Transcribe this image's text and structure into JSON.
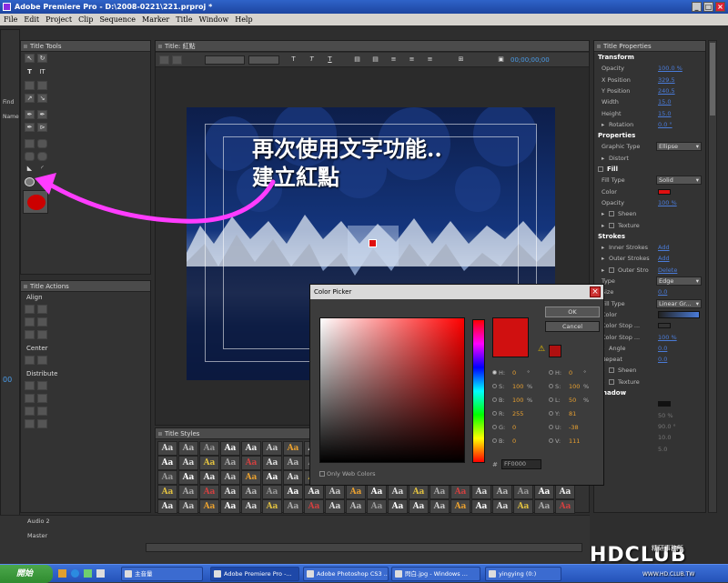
{
  "window": {
    "title": "Adobe Premiere Pro - D:\\2008-0221\\221.prproj *"
  },
  "menu": [
    "File",
    "Edit",
    "Project",
    "Clip",
    "Sequence",
    "Marker",
    "Title",
    "Window",
    "Help"
  ],
  "title_tools": {
    "tab": "Title Tools"
  },
  "title_actions": {
    "tab": "Title Actions",
    "align": "Align",
    "center": "Center",
    "distribute": "Distribute"
  },
  "title_panel": {
    "tab": "Title: 紅點",
    "timecode": "00;00;00;00"
  },
  "annotation": "再次使用文字功能..\n建立紅點",
  "title_styles": {
    "tab": "Title Styles",
    "sample": "Aa"
  },
  "left_side": {
    "find": "Find",
    "name": "Name",
    "timecode": "00"
  },
  "timeline": {
    "audio2": "Audio 2",
    "master": "Master"
  },
  "properties": {
    "tab": "Title Properties",
    "rows": [
      {
        "type": "section",
        "label": "Transform"
      },
      {
        "label": "Opacity",
        "value": "100.0 %"
      },
      {
        "label": "X Position",
        "value": "329.5"
      },
      {
        "label": "Y Position",
        "value": "240.5"
      },
      {
        "label": "Width",
        "value": "15.0"
      },
      {
        "label": "Height",
        "value": "15.0"
      },
      {
        "label": "Rotation",
        "value": "0.0 °",
        "arrow": true
      },
      {
        "type": "section",
        "label": "Properties"
      },
      {
        "label": "Graphic Type",
        "dropdown": "Ellipse"
      },
      {
        "label": "Distort",
        "arrow": true
      },
      {
        "type": "section",
        "label": "Fill",
        "check": true
      },
      {
        "label": "Fill Type",
        "dropdown": "Solid"
      },
      {
        "label": "Color",
        "swatch": "#e01010"
      },
      {
        "label": "Opacity",
        "value": "100 %"
      },
      {
        "label": "Sheen",
        "check": true,
        "arrow": true
      },
      {
        "label": "Texture",
        "check": true,
        "arrow": true
      },
      {
        "type": "section",
        "label": "Strokes"
      },
      {
        "label": "Inner Strokes",
        "value": "Add",
        "arrow": true
      },
      {
        "label": "Outer Strokes",
        "value": "Add",
        "arrow": true
      },
      {
        "label": "Outer Stro",
        "value": "Delete",
        "check": true,
        "arrow": true
      },
      {
        "label": "Type",
        "dropdown": "Edge"
      },
      {
        "label": "Size",
        "value": "0.0"
      },
      {
        "label": "Fill Type",
        "dropdown": "Linear Gr..."
      },
      {
        "label": "Color",
        "gradient": true
      },
      {
        "label": "Color Stop ...",
        "swatch": "#333333"
      },
      {
        "label": "Color Stop ...",
        "value": "100 %"
      },
      {
        "label": "Angle",
        "value": "0.0",
        "arrow": true
      },
      {
        "label": "Repeat",
        "value": "0.0"
      },
      {
        "label": "Sheen",
        "check": true,
        "arrow": true
      },
      {
        "label": "Texture",
        "check": true,
        "arrow": true
      },
      {
        "type": "section",
        "label": "Shadow"
      },
      {
        "label": "",
        "swatch": "#111111"
      },
      {
        "label": "",
        "value": "50 %",
        "dim": true
      },
      {
        "label": "",
        "value": "90.0 °",
        "dim": true
      },
      {
        "label": "",
        "value": "10.0",
        "dim": true
      },
      {
        "label": "",
        "value": "5.0",
        "dim": true
      }
    ]
  },
  "color_picker": {
    "title": "Color Picker",
    "ok": "OK",
    "cancel": "Cancel",
    "only_web": "Only Web Colors",
    "hex": "FF0000",
    "swatch": "#d01010",
    "warn_swatch": "#b01010",
    "left": [
      {
        "k": "H:",
        "v": "0",
        "u": "°",
        "checked": true
      },
      {
        "k": "S:",
        "v": "100",
        "u": "%"
      },
      {
        "k": "B:",
        "v": "100",
        "u": "%"
      },
      {
        "k": "R:",
        "v": "255",
        "u": ""
      },
      {
        "k": "G:",
        "v": "0",
        "u": ""
      },
      {
        "k": "B:",
        "v": "0",
        "u": ""
      }
    ],
    "right": [
      {
        "k": "H:",
        "v": "0",
        "u": "°"
      },
      {
        "k": "S:",
        "v": "100",
        "u": "%"
      },
      {
        "k": "L:",
        "v": "50",
        "u": "%"
      },
      {
        "k": "Y:",
        "v": "81",
        "u": ""
      },
      {
        "k": "U:",
        "v": "-38",
        "u": ""
      },
      {
        "k": "V:",
        "v": "111",
        "u": ""
      }
    ]
  },
  "taskbar": {
    "start": "開始",
    "buttons": [
      "主音量",
      "Adobe Premiere Pro -...",
      "Adobe Photoshop CS3 ...",
      "閃白.jpg - Windows ...",
      "yingying (0:)"
    ]
  },
  "logo": {
    "main": "HDCLUB",
    "sub": "精研事務所",
    "url": "WWW.HD.CLUB.TW"
  }
}
